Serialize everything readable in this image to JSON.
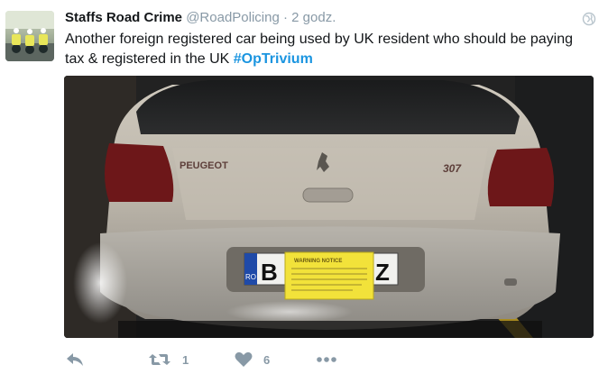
{
  "tweet": {
    "author_name": "Staffs Road Crime",
    "handle": "@RoadPolicing",
    "separator": "·",
    "time": "2 godz.",
    "text": "Another foreign registered car being used by UK resident who should be paying tax & registered in the UK",
    "hashtag": "#OpTrivium"
  },
  "media": {
    "badge_text": "PEUGEOT",
    "model_text": "307",
    "plate_left": "B",
    "plate_right": "Z",
    "plate_country": "RO",
    "notice_title": "WARNING NOTICE"
  },
  "actions": {
    "reply_icon": "reply-icon",
    "retweet_icon": "retweet-icon",
    "retweet_count": "1",
    "like_icon": "heart-icon",
    "like_count": "6",
    "more_icon": "more-icon"
  },
  "colors": {
    "hashtag": "#1b95e0",
    "meta_grey": "#8899a6",
    "action_grey": "#8899a6"
  }
}
